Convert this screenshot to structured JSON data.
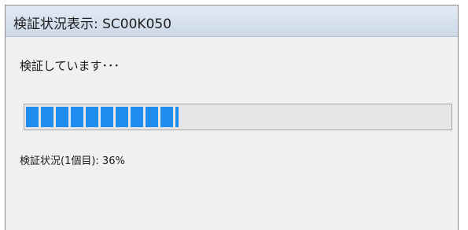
{
  "window": {
    "title": "検証状況表示: SC00K050"
  },
  "main": {
    "status_message": "検証しています･･･",
    "progress": {
      "value_percent": 36,
      "caption": "検証状況(1個目): 36%"
    }
  },
  "colors": {
    "progress_fill": "#1e8bf0",
    "titlebar": "#d6e1ee",
    "window_background": "#f0f0f0"
  }
}
